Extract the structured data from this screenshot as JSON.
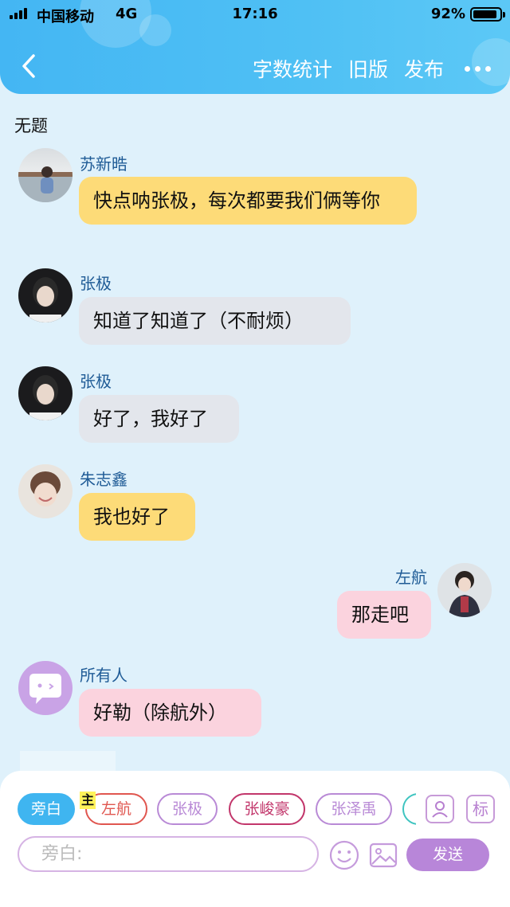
{
  "status_bar": {
    "carrier": "中国移动",
    "network": "4G",
    "time": "17:16",
    "battery": "92%",
    "battery_level": 0.92
  },
  "nav": {
    "stats": "字数统计",
    "old_version": "旧版",
    "publish": "发布"
  },
  "doc_title": "无题",
  "messages": [
    {
      "name": "苏新晧",
      "text": "快点呐张极，每次都要我们俩等你",
      "color": "#fddb78"
    },
    {
      "name": "张极",
      "text": "知道了知道了（不耐烦）",
      "color": "#e3e6ec"
    },
    {
      "name": "张极",
      "text": "好了，我好了",
      "color": "#e3e6ec"
    },
    {
      "name": "朱志鑫",
      "text": "我也好了",
      "color": "#fddb78"
    },
    {
      "name": "左航",
      "text": "那走吧",
      "color": "#fbd3de"
    },
    {
      "name": "所有人",
      "text": "好勒（除航外）",
      "color": "#fbd3de"
    }
  ],
  "chips": [
    {
      "label": "旁白",
      "active": true
    },
    {
      "label": "左航",
      "color": "#e0564f"
    },
    {
      "label": "张极",
      "color": "#b98ad6"
    },
    {
      "label": "张峻豪",
      "color": "#c2366b"
    },
    {
      "label": "张泽禹",
      "color": "#b98ad6"
    }
  ],
  "main_badge": "主",
  "tools": {
    "role_icon": "user-card-icon",
    "tag_label": "标"
  },
  "input": {
    "placeholder": "旁白:"
  },
  "send_label": "发送"
}
